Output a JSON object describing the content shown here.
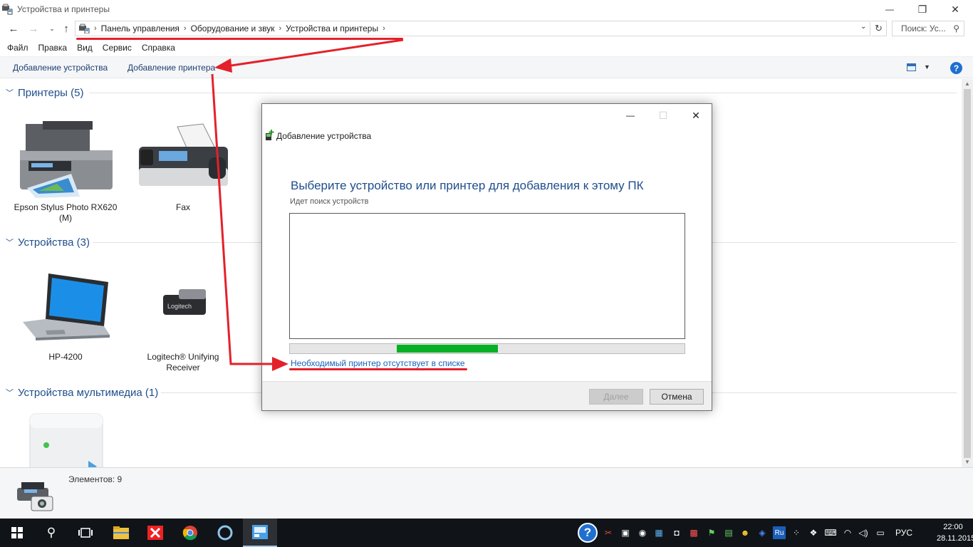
{
  "window": {
    "title": "Устройства и принтеры",
    "minimize": "—",
    "restore": "❐",
    "close": "✕"
  },
  "address": {
    "crumbs": [
      "Панель управления",
      "Оборудование и звук",
      "Устройства и принтеры"
    ],
    "search_placeholder": "Поиск: Ус..."
  },
  "menu": [
    "Файл",
    "Правка",
    "Вид",
    "Сервис",
    "Справка"
  ],
  "commands": {
    "add_device": "Добавление устройства",
    "add_printer": "Добавление принтера",
    "help": "?"
  },
  "groups": {
    "printers": {
      "title": "Принтеры (5)",
      "items": [
        "Epson Stylus Photo RX620 (M)",
        "Fax"
      ]
    },
    "devices": {
      "title": "Устройства (3)",
      "items": [
        "HP-4200",
        "Logitech® Unifying Receiver"
      ]
    },
    "multimedia": {
      "title": "Устройства мультимедиа (1)"
    }
  },
  "status": {
    "count": "Элементов: 9"
  },
  "dialog": {
    "title": "Добавление устройства",
    "heading": "Выберите устройство или принтер для добавления к этому ПК",
    "subtitle": "Идет поиск устройств",
    "progress_fraction": 0.27,
    "progress_start_fraction": 0.27,
    "link": "Необходимый принтер отсутствует в списке",
    "next_button": "Далее",
    "cancel_button": "Отмена"
  },
  "taskbar": {
    "lang": "РУС",
    "time": "22:00",
    "date": "28.11.2015"
  },
  "colors": {
    "accent_blue": "#1e4e8c",
    "link_blue": "#1960b8",
    "annotation_red": "#e3212b",
    "progress_green": "#06b025",
    "taskbar": "#101418"
  }
}
